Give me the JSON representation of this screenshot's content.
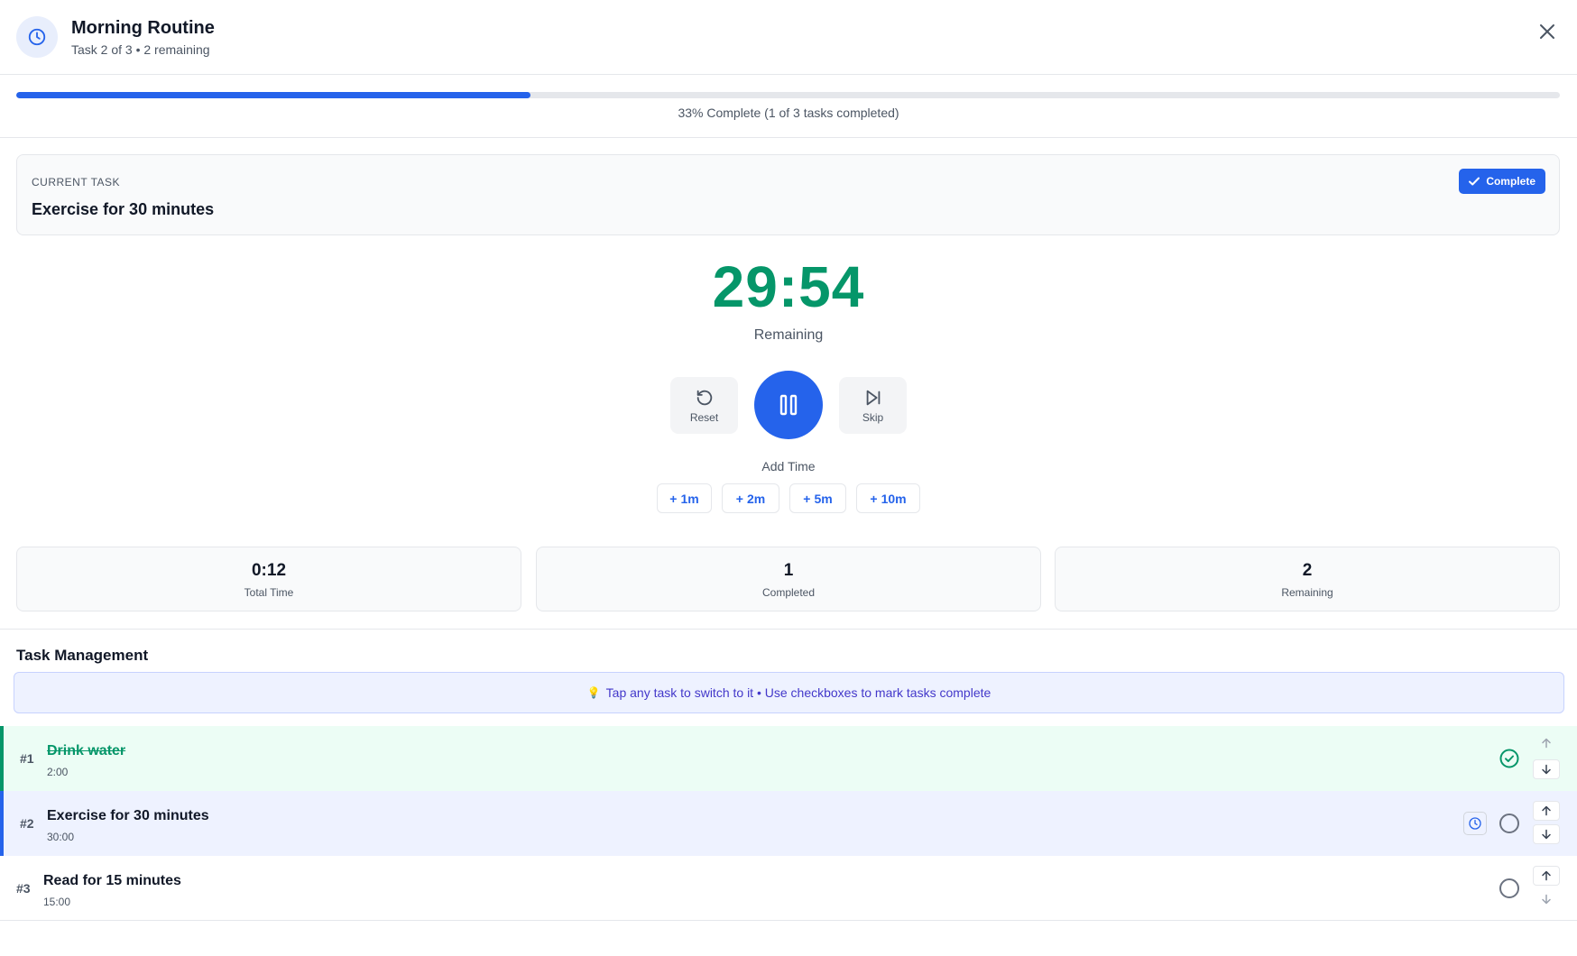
{
  "header": {
    "title": "Morning Routine",
    "subtitle": "Task 2 of 3 • 2 remaining"
  },
  "progress": {
    "percent": 33.3,
    "text": "33% Complete (1 of 3 tasks completed)"
  },
  "current_task": {
    "label": "CURRENT TASK",
    "name": "Exercise for 30 minutes",
    "complete_label": "Complete"
  },
  "timer": {
    "value": "29:54",
    "caption": "Remaining"
  },
  "controls": {
    "reset_label": "Reset",
    "skip_label": "Skip"
  },
  "add_time": {
    "label": "Add Time",
    "options": [
      "1m",
      "2m",
      "5m",
      "10m"
    ]
  },
  "stats": [
    {
      "value": "0:12",
      "caption": "Total Time"
    },
    {
      "value": "1",
      "caption": "Completed"
    },
    {
      "value": "2",
      "caption": "Remaining"
    }
  ],
  "task_management": {
    "title": "Task Management",
    "hint_icon": "💡",
    "hint": "Tap any task to switch to it • Use checkboxes to mark tasks complete"
  },
  "tasks": [
    {
      "number": "#1",
      "name": "Drink water",
      "duration": "2:00",
      "status": "completed"
    },
    {
      "number": "#2",
      "name": "Exercise for 30 minutes",
      "duration": "30:00",
      "status": "active"
    },
    {
      "number": "#3",
      "name": "Read for 15 minutes",
      "duration": "15:00",
      "status": "pending"
    }
  ],
  "colors": {
    "accent": "#2563eb",
    "success": "#059669",
    "completed_row_bg": "#ecfdf5",
    "active_row_bg": "#eef2ff"
  }
}
